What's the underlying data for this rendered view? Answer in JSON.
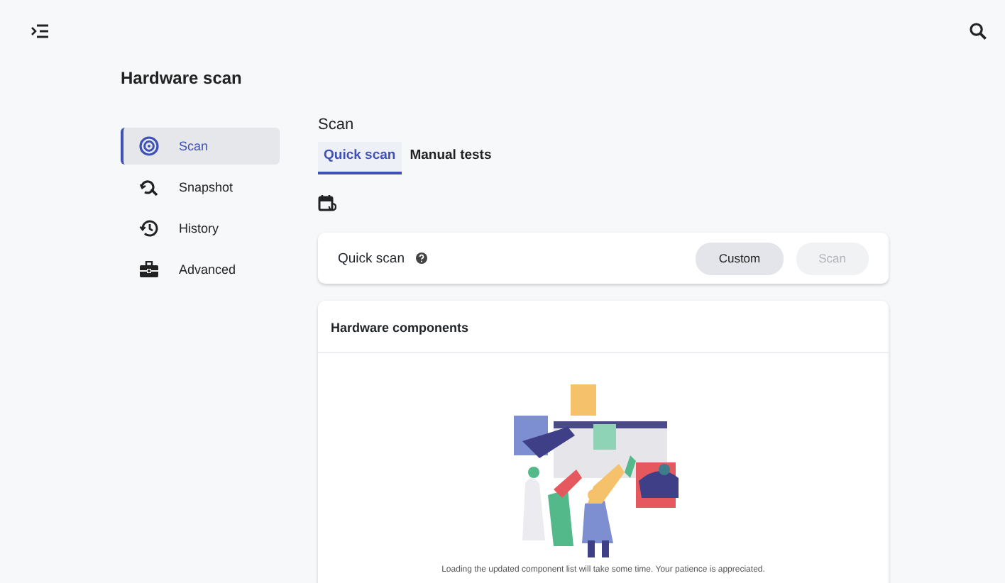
{
  "page": {
    "title": "Hardware scan"
  },
  "sidebar": {
    "items": [
      {
        "label": "Scan",
        "selected": true
      },
      {
        "label": "Snapshot",
        "selected": false
      },
      {
        "label": "History",
        "selected": false
      },
      {
        "label": "Advanced",
        "selected": false
      }
    ]
  },
  "main": {
    "heading": "Scan",
    "tabs": [
      {
        "label": "Quick scan",
        "selected": true
      },
      {
        "label": "Manual tests",
        "selected": false
      }
    ],
    "quick_scan_card": {
      "title": "Quick scan",
      "buttons": [
        {
          "label": "Custom",
          "disabled": false
        },
        {
          "label": "Scan",
          "disabled": true
        }
      ]
    },
    "components_card": {
      "title": "Hardware components",
      "message": "Loading the updated component list will take some time. Your patience is appreciated."
    }
  }
}
